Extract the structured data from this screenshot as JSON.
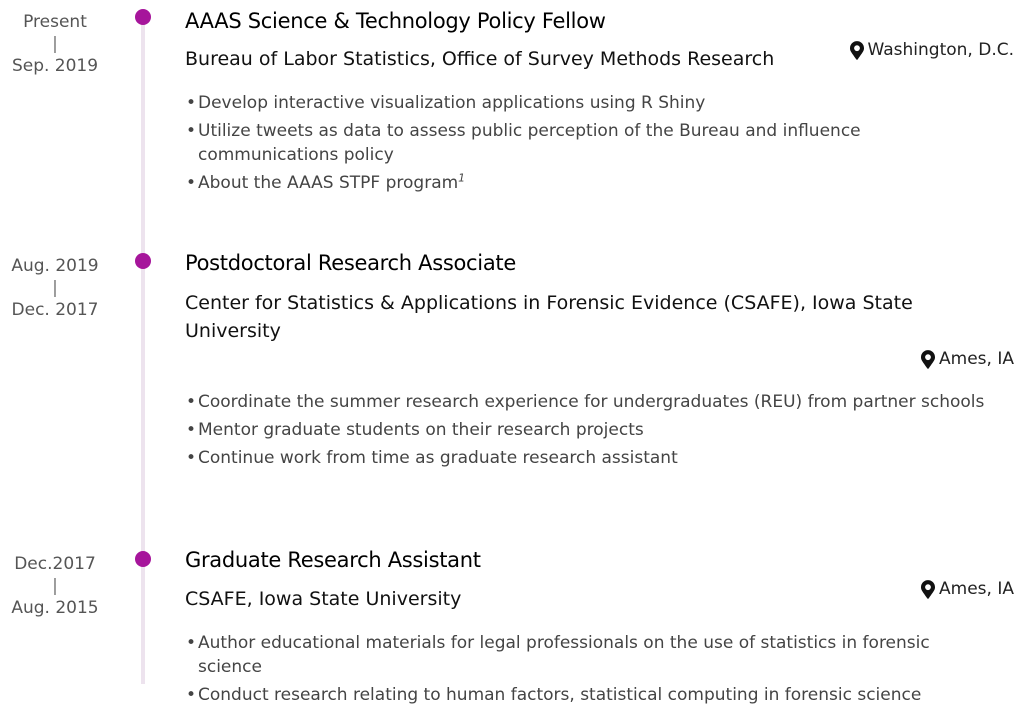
{
  "entries": [
    {
      "date_end": "Present",
      "date_sep": "|",
      "date_start": "Sep. 2019",
      "title": "AAAS Science & Technology Policy Fellow",
      "organization": "Bureau of Labor Statistics, Office of Survey Methods Research",
      "location": "Washington, D.C.",
      "location_icon": "map-marker-icon",
      "bullets": [
        "Develop interactive visualization applications using R Shiny",
        "Utilize tweets as data to assess public perception of the Bureau and influence communications policy",
        "About the AAAS STPF program"
      ],
      "footnote_mark": "1"
    },
    {
      "date_end": "Aug. 2019",
      "date_sep": "|",
      "date_start": "Dec. 2017",
      "title": "Postdoctoral Research Associate",
      "organization": "Center for Statistics & Applications in Forensic Evidence (CSAFE), Iowa State University",
      "location": "Ames, IA",
      "location_icon": "map-marker-icon",
      "bullets": [
        "Coordinate the summer research experience for undergraduates (REU) from partner schools",
        "Mentor graduate students on their research projects",
        "Continue work from time as graduate research assistant"
      ]
    },
    {
      "date_end": "Dec.2017",
      "date_sep": "|",
      "date_start": "Aug. 2015",
      "title": "Graduate Research Assistant",
      "organization": "CSAFE, Iowa State University",
      "location": "Ames, IA",
      "location_icon": "map-marker-icon",
      "bullets": [
        "Author educational materials for legal professionals on the use of statistics in forensic science",
        "Conduct research relating to human factors, statistical computing in forensic science"
      ]
    }
  ],
  "colors": {
    "accent": "#a6159b",
    "timeline": "#ede3ee"
  }
}
